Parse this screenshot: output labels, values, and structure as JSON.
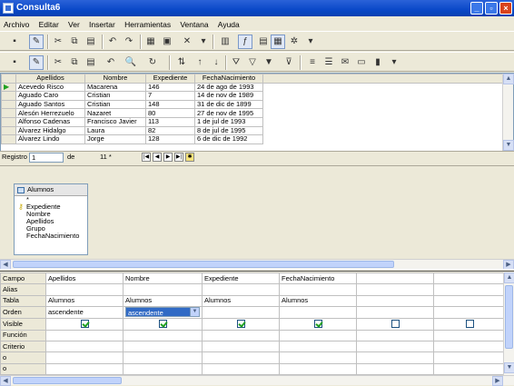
{
  "window": {
    "title": "Consulta6"
  },
  "menu": [
    "Archivo",
    "Editar",
    "Ver",
    "Insertar",
    "Herramientas",
    "Ventana",
    "Ayuda"
  ],
  "datagrid": {
    "columns": [
      "Apellidos",
      "Nombre",
      "Expediente",
      "FechaNacimiento"
    ],
    "rows": [
      [
        "Acevedo Risco",
        "Macarena",
        "146",
        "24 de ago de 1993"
      ],
      [
        "Aguado Caro",
        "Cristian",
        "7",
        "14 de nov de 1989"
      ],
      [
        "Aguado Santos",
        "Cristian",
        "148",
        "31 de dic de 1899"
      ],
      [
        "Alesón Herrezuelo",
        "Nazaret",
        "80",
        "27 de nov de 1995"
      ],
      [
        "Alfonso Cadenas",
        "Francisco Javier",
        "113",
        "1 de jul de 1993"
      ],
      [
        "Álvarez Hidalgo",
        "Laura",
        "82",
        "8 de jul de 1995"
      ],
      [
        "Álvarez Lindo",
        "Jorge",
        "128",
        "6 de dic de 1992"
      ]
    ]
  },
  "navigator": {
    "label": "Registro",
    "current": "1",
    "of_label": "de",
    "total": "11 *"
  },
  "table_box": {
    "name": "Alumnos",
    "fields": [
      "*",
      "Expediente",
      "Nombre",
      "Apellidos",
      "Grupo",
      "FechaNacimiento"
    ]
  },
  "design": {
    "row_labels": [
      "Campo",
      "Alias",
      "Tabla",
      "Orden",
      "Visible",
      "Función",
      "Criterio",
      "o",
      "o"
    ],
    "columns": [
      {
        "campo": "Apellidos",
        "tabla": "Alumnos",
        "orden": "ascendente",
        "visible": true
      },
      {
        "campo": "Nombre",
        "tabla": "Alumnos",
        "orden": "ascendente",
        "visible": true,
        "orden_editing": true
      },
      {
        "campo": "Expediente",
        "tabla": "Alumnos",
        "orden": "",
        "visible": true
      },
      {
        "campo": "FechaNacimiento",
        "tabla": "Alumnos",
        "orden": "",
        "visible": true
      },
      {
        "campo": "",
        "tabla": "",
        "orden": "",
        "visible": false
      },
      {
        "campo": "",
        "tabla": "",
        "orden": "",
        "visible": false
      }
    ]
  }
}
